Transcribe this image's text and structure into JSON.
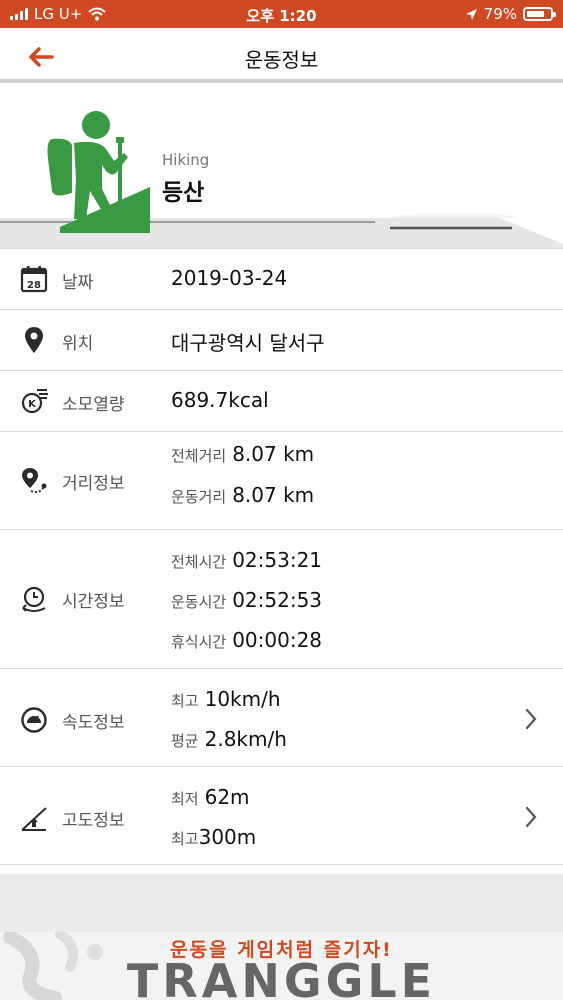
{
  "status_bar": {
    "carrier": "LG U+",
    "time": "오후 1:20",
    "battery": "79%",
    "battery_level": 0.79
  },
  "nav": {
    "title": "운동정보"
  },
  "activity": {
    "name_en": "Hiking",
    "name_ko": "등산"
  },
  "rows": {
    "date": {
      "label": "날짜",
      "value": "2019-03-24"
    },
    "location": {
      "label": "위치",
      "value": "대구광역시 달서구"
    },
    "calories": {
      "label": "소모열량",
      "value": "689.7kcal"
    },
    "distance": {
      "label": "거리정보",
      "total_label": "전체거리",
      "total_value": "8.07 km",
      "moving_label": "운동거리",
      "moving_value": "8.07 km"
    },
    "time": {
      "label": "시간정보",
      "total_label": "전체시간",
      "total_value": "02:53:21",
      "moving_label": "운동시간",
      "moving_value": "02:52:53",
      "rest_label": "휴식시간",
      "rest_value": "00:00:28"
    },
    "speed": {
      "label": "속도정보",
      "max_label": "최고",
      "max_value": "10km/h",
      "avg_label": "평균",
      "avg_value": "2.8km/h"
    },
    "altitude": {
      "label": "고도정보",
      "min_label": "최저",
      "min_value": "62m",
      "max_label": "최고",
      "max_value": "300m"
    }
  },
  "banner": {
    "slogan": "운동을 게임처럼 즐기자!",
    "brand": "TRANGGLE"
  },
  "colors": {
    "accent": "#cf4a22",
    "hiker_green": "#3a9a44",
    "icon_dark": "#2b2b2b"
  }
}
